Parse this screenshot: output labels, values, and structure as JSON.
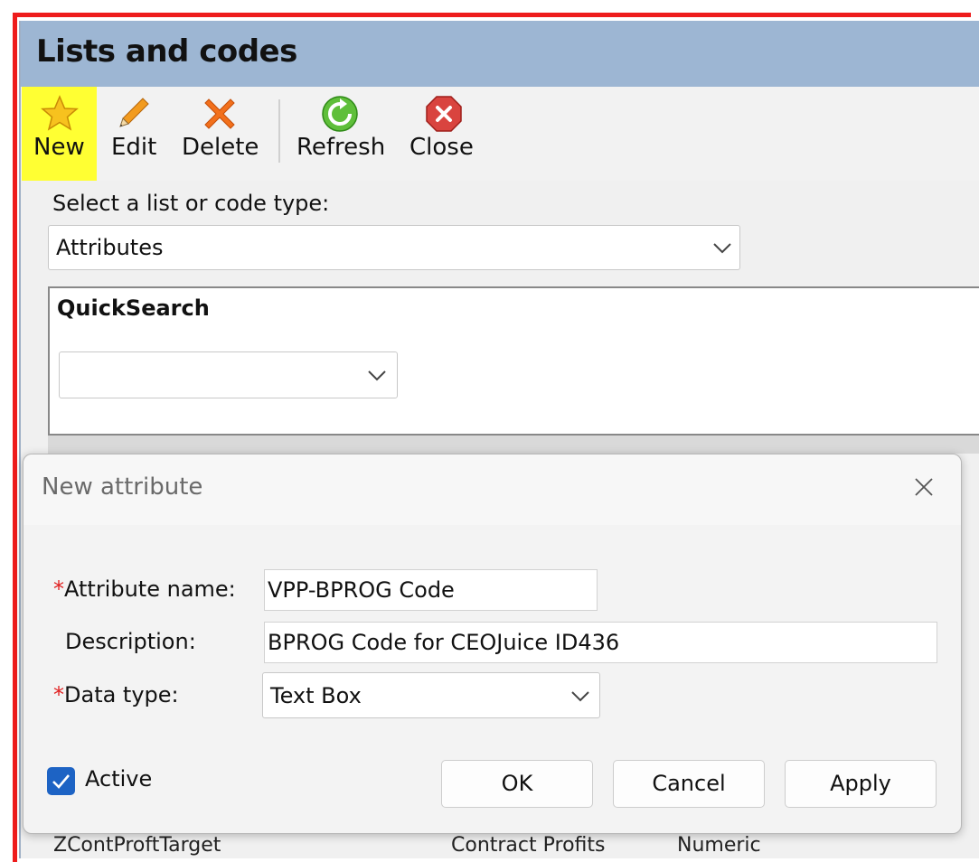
{
  "window": {
    "title": "Lists and codes"
  },
  "toolbar": {
    "new_label": "New",
    "edit_label": "Edit",
    "delete_label": "Delete",
    "refresh_label": "Refresh",
    "close_label": "Close",
    "highlight_color": "#ffff33"
  },
  "list_select": {
    "label": "Select a list or code type:",
    "value": "Attributes"
  },
  "quicksearch": {
    "title": "QuickSearch",
    "value": ""
  },
  "background_row": {
    "name": "ZContProftTarget",
    "category": "Contract Profits",
    "type": "Numeric"
  },
  "dialog": {
    "title": "New attribute",
    "required_mark": "*",
    "attribute_name_label": "Attribute name:",
    "attribute_name_value": "VPP-BPROG Code",
    "description_label": "Description:",
    "description_value": "BPROG Code for CEOJuice ID436",
    "data_type_label": "Data type:",
    "data_type_value": "Text Box",
    "active_label": "Active",
    "active_checked": true,
    "ok_label": "OK",
    "cancel_label": "Cancel",
    "apply_label": "Apply"
  }
}
